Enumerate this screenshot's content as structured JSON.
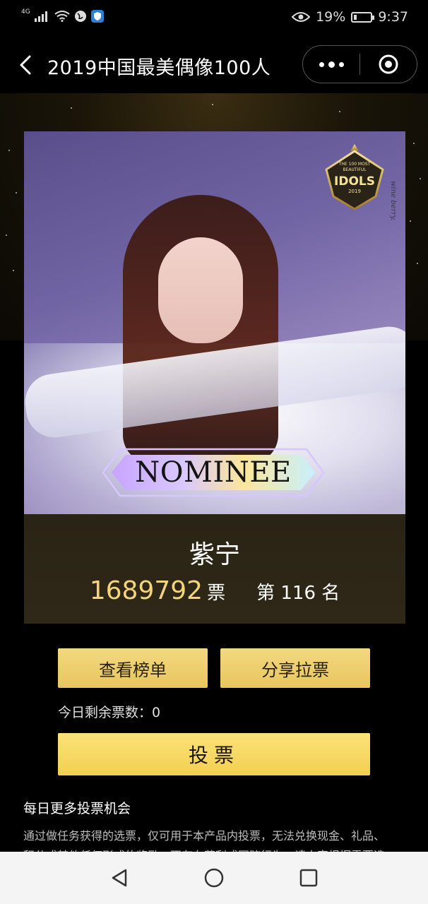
{
  "status_bar": {
    "network": "4G",
    "battery_percent": "19%",
    "battery_level": 0.19,
    "time": "9:37"
  },
  "navbar": {
    "title": "2019中国最美偶像100人"
  },
  "card": {
    "badge_line1": "THE 100 MOST",
    "badge_line2": "BEAUTIFUL",
    "badge_main": "IDOLS",
    "badge_year": "2019",
    "side_text": "wine berry.",
    "nominee": "NOMINEE",
    "name": "紫宁",
    "votes": "1689792",
    "vote_unit": "票",
    "rank": "第 116 名"
  },
  "actions": {
    "view_rank": "查看榜单",
    "share_vote": "分享拉票",
    "remaining_label": "今日剩余票数：0",
    "vote": "投票"
  },
  "more": {
    "title": "每日更多投票机会",
    "desc_line1": "通过做任务获得的选票，仅可用于本产品内投票，无法兑换现金、礼品、",
    "desc_line2": "积分或其他任何形式的奖励，不存在获利或网赌行为，请大家根据需要选"
  },
  "colors": {
    "gold": "#e8c65e",
    "vote_gold": "#f2cf50",
    "count_gold": "#f4d57a"
  },
  "icons": {
    "back": "chevron-left-icon",
    "more": "more-dots-icon",
    "close": "target-circle-icon",
    "nav_back": "triangle-back-icon",
    "nav_home": "circle-home-icon",
    "nav_recent": "square-recent-icon"
  }
}
